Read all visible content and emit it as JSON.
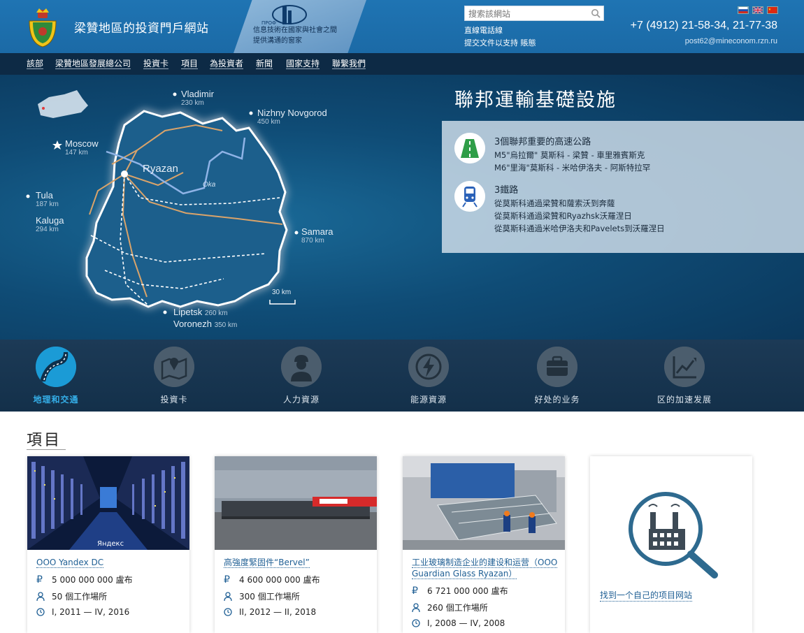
{
  "header": {
    "site_title": "梁贊地區的投資門戶網站",
    "banner_text_1": "信息技術在國家與社會之間",
    "banner_text_2": "提供溝通的窗家",
    "search_placeholder": "搜索該網站",
    "link_hotline": "直線電話線",
    "link_submit": "提交文件以支持 賬態",
    "phone": "+7 (4912) 21-58-34, 21-77-38",
    "email": "post62@mineconom.rzn.ru",
    "languages": [
      "ru",
      "en",
      "zh"
    ]
  },
  "nav": {
    "items": [
      "該部",
      "梁贊地區發展總公司",
      "投資卡",
      "項目",
      "為投資者",
      "新聞",
      "國家支持",
      "聯繫我們"
    ]
  },
  "hero": {
    "title": "聯邦運輸基礎設施",
    "map": {
      "center_city": "Ryazan",
      "river": "Oka",
      "scale": "30 km",
      "cities": [
        {
          "name": "Vladimir",
          "dist": "230 km"
        },
        {
          "name": "Nizhny Novgorod",
          "dist": "450 km"
        },
        {
          "name": "Moscow",
          "dist": "147 km"
        },
        {
          "name": "Tula",
          "dist": "187 km"
        },
        {
          "name": "Kaluga",
          "dist": "294 km"
        },
        {
          "name": "Samara",
          "dist": "870 km"
        },
        {
          "name": "Lipetsk",
          "dist": "260 km"
        },
        {
          "name": "Voronezh",
          "dist": "350 km"
        }
      ]
    },
    "highways": {
      "title": "3個聯邦重要的高速公路",
      "lines": [
        "M5\"烏拉爾\" 莫斯科 - 梁贊 - 車里雅賓斯克",
        "M6\"里海\"莫斯科 - 米哈伊洛夫 - 阿斯特拉罕"
      ]
    },
    "railways": {
      "title": "3鐵路",
      "lines": [
        "從莫斯科通過梁贊和薩索沃到奔薩",
        "從莫斯科通過梁贊和Ryazhsk沃羅涅日",
        "從莫斯科通過米哈伊洛夫和Pavelets到沃羅涅日"
      ]
    }
  },
  "categories": [
    {
      "label": "地理和交通",
      "icon": "road-icon",
      "active": true
    },
    {
      "label": "投資卡",
      "icon": "map-icon",
      "active": false
    },
    {
      "label": "人力資源",
      "icon": "worker-icon",
      "active": false
    },
    {
      "label": "能源資源",
      "icon": "energy-icon",
      "active": false
    },
    {
      "label": "好处的业务",
      "icon": "briefcase-icon",
      "active": false
    },
    {
      "label": "区的加速发展",
      "icon": "growth-chart-icon",
      "active": false
    }
  ],
  "projects": {
    "title": "項目",
    "cards": [
      {
        "title": "OOO Yandex DC",
        "money": "5 000 000 000 盧布",
        "jobs": "50 個工作場所",
        "period": "I, 2011 — IV, 2016",
        "img_label": "Яндекс"
      },
      {
        "title": "高強度緊固件“Bervel”",
        "money": "4 600 000 000 盧布",
        "jobs": "300 個工作場所",
        "period": "II, 2012 — II, 2018"
      },
      {
        "title": "工业玻璃制造企业的建设和运营（OOO Guardian Glass Ryazan）",
        "money": "6 721 000 000 盧布",
        "jobs": "260 個工作場所",
        "period": "I, 2008 — IV, 2008"
      }
    ],
    "find_label": "找到一个自己的项目网站"
  }
}
